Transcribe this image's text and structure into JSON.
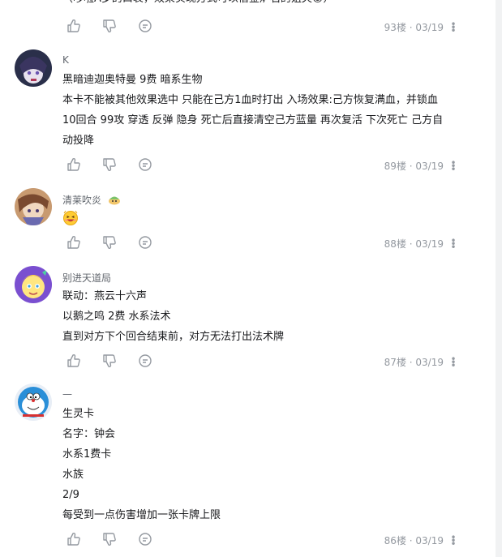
{
  "comments": [
    {
      "lines": [
        "（哆啦A梦的口袋，效果实现方式可以借鉴炉石的姐夫😊）"
      ],
      "floor": "93楼",
      "date": "03/19"
    },
    {
      "user": "K",
      "lines": [
        "黑暗迪迦奥特曼 9费 暗系生物",
        "本卡不能被其他效果选中 只能在己方1血时打出 入场效果:己方恢复满血，并锁血",
        "10回合 99攻 穿透 反弹 隐身 死亡后直接清空己方蓝量 再次复活 下次死亡 己方自",
        "动投降"
      ],
      "floor": "89楼",
      "date": "03/19"
    },
    {
      "user": "清莱吹炎",
      "lines": [],
      "floor": "88楼",
      "date": "03/19"
    },
    {
      "user": "别进天道局",
      "lines": [
        "联动：燕云十六声",
        "以鹅之鸣 2费 水系法术",
        "直到对方下个回合结束前，对方无法打出法术牌"
      ],
      "floor": "87楼",
      "date": "03/19"
    },
    {
      "user": "—",
      "lines": [
        "生灵卡",
        "名字：钟会",
        "水系1费卡",
        "水族",
        "2/9",
        "每受到一点伤害增加一张卡牌上限"
      ],
      "floor": "86楼",
      "date": "03/19"
    }
  ],
  "icons": {
    "like": "thumbs-up-icon",
    "dislike": "thumbs-down-icon",
    "reply": "reply-bubble-icon",
    "more": "more-vertical-icon"
  },
  "colors": {
    "text": "#18191c",
    "username": "#61666d",
    "meta": "#9499a0"
  }
}
